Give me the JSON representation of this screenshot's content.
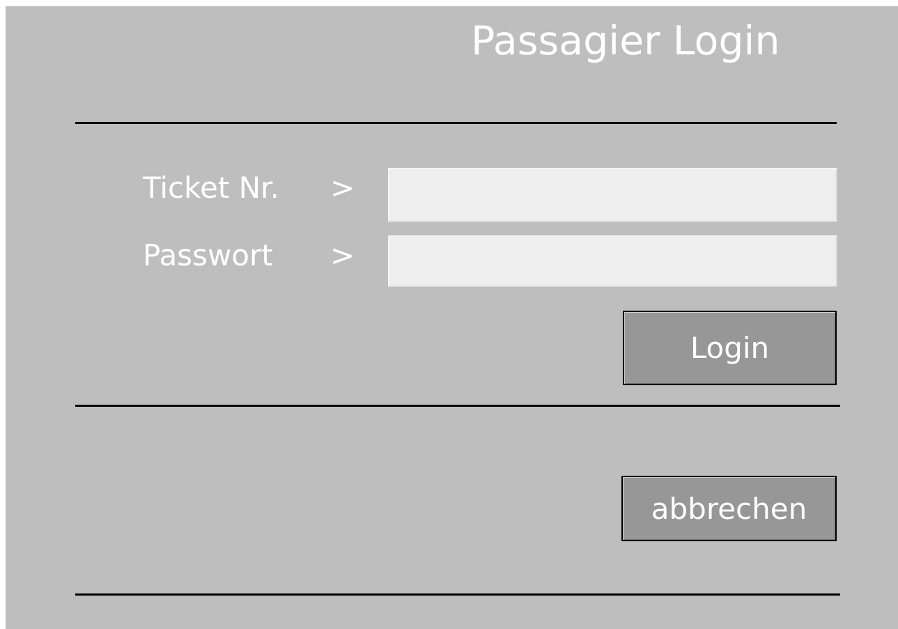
{
  "header": {
    "title": "Passagier Login"
  },
  "form": {
    "ticket": {
      "label": "Ticket Nr.",
      "arrow": ">",
      "value": "",
      "placeholder": ""
    },
    "password": {
      "label": "Passwort",
      "arrow": ">",
      "value": "",
      "placeholder": ""
    },
    "login_label": "Login"
  },
  "footer": {
    "cancel_label": "abbrechen"
  },
  "colors": {
    "panel_background": "#bebebe",
    "input_background": "#eeeeee",
    "button_background": "#979797",
    "text": "#ffffff",
    "rule": "#000000"
  }
}
